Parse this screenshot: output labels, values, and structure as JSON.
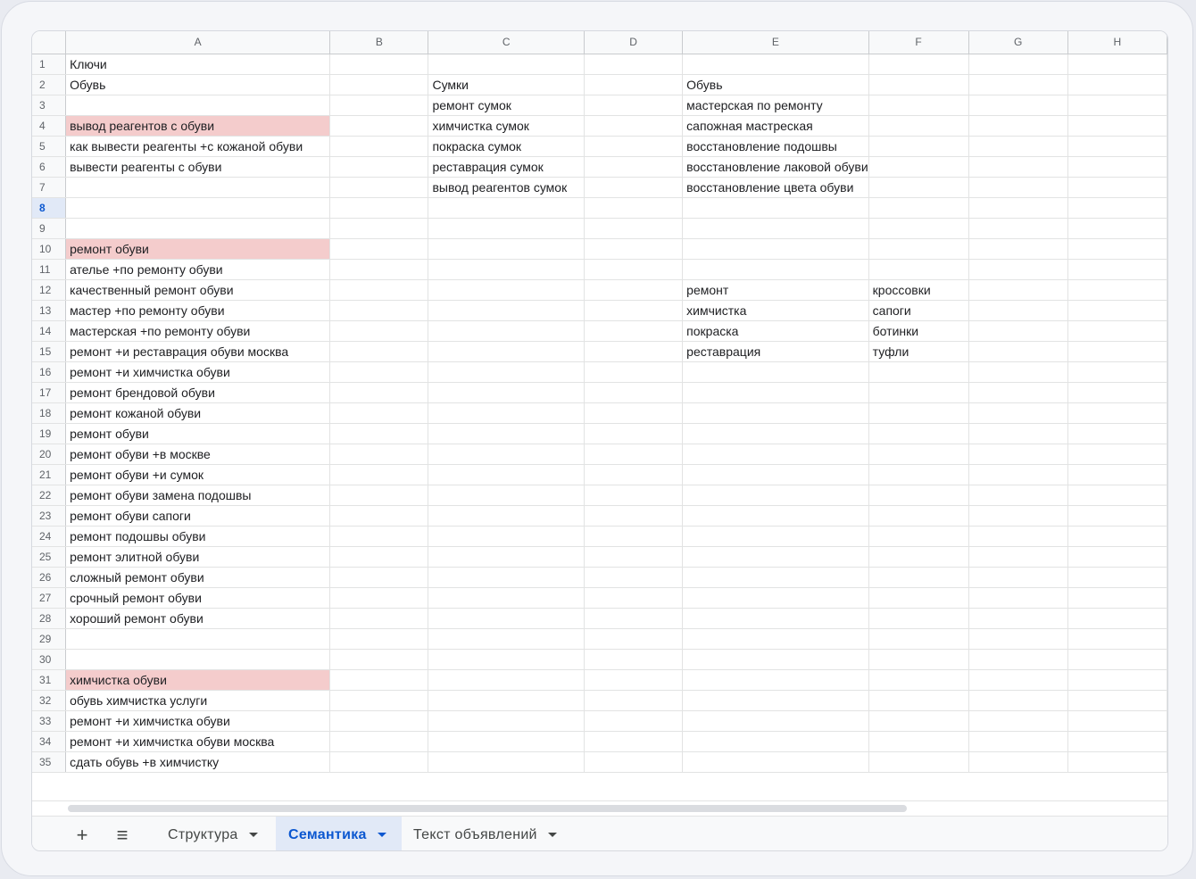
{
  "columns": [
    "A",
    "B",
    "C",
    "D",
    "E",
    "F",
    "G",
    "H"
  ],
  "active_row": 8,
  "highlight_color": "#f4cccc",
  "rows": [
    {
      "n": "1",
      "A": "Ключи"
    },
    {
      "n": "2",
      "A": "Обувь",
      "C": "Сумки",
      "E": "Обувь"
    },
    {
      "n": "3",
      "C": "ремонт сумок",
      "E": "мастерская по ремонту"
    },
    {
      "n": "4",
      "A": "вывод реагентов с обуви",
      "hl": true,
      "C": "химчистка сумок",
      "E": "сапожная мастреская"
    },
    {
      "n": "5",
      "A": "как вывести реагенты +с кожаной обуви",
      "C": "покраска сумок",
      "E": "восстановление подошвы"
    },
    {
      "n": "6",
      "A": "вывести реагенты с обуви",
      "C": "реставрация сумок",
      "E": "восстановление лаковой обуви"
    },
    {
      "n": "7",
      "C": "вывод реагентов сумок",
      "E": "восстановление цвета обуви"
    },
    {
      "n": "8"
    },
    {
      "n": "9"
    },
    {
      "n": "10",
      "A": "ремонт обуви",
      "hl": true
    },
    {
      "n": "11",
      "A": "ателье +по ремонту обуви"
    },
    {
      "n": "12",
      "A": "качественный ремонт обуви",
      "E": "ремонт",
      "F": "кроссовки"
    },
    {
      "n": "13",
      "A": "мастер +по ремонту обуви",
      "E": "химчистка",
      "F": "сапоги"
    },
    {
      "n": "14",
      "A": "мастерская +по ремонту обуви",
      "E": "покраска",
      "F": "ботинки"
    },
    {
      "n": "15",
      "A": "ремонт +и реставрация обуви москва",
      "E": "реставрация",
      "F": "туфли"
    },
    {
      "n": "16",
      "A": "ремонт +и химчистка обуви"
    },
    {
      "n": "17",
      "A": "ремонт брендовой обуви"
    },
    {
      "n": "18",
      "A": "ремонт кожаной обуви"
    },
    {
      "n": "19",
      "A": "ремонт обуви"
    },
    {
      "n": "20",
      "A": "ремонт обуви +в москве"
    },
    {
      "n": "21",
      "A": "ремонт обуви +и сумок"
    },
    {
      "n": "22",
      "A": "ремонт обуви замена подошвы"
    },
    {
      "n": "23",
      "A": "ремонт обуви сапоги"
    },
    {
      "n": "24",
      "A": "ремонт подошвы обуви"
    },
    {
      "n": "25",
      "A": "ремонт элитной обуви"
    },
    {
      "n": "26",
      "A": "сложный ремонт обуви"
    },
    {
      "n": "27",
      "A": "срочный ремонт обуви"
    },
    {
      "n": "28",
      "A": "хороший ремонт обуви"
    },
    {
      "n": "29"
    },
    {
      "n": "30"
    },
    {
      "n": "31",
      "A": "химчистка обуви",
      "hl": true
    },
    {
      "n": "32",
      "A": "обувь химчистка услуги"
    },
    {
      "n": "33",
      "A": "ремонт +и химчистка обуви"
    },
    {
      "n": "34",
      "A": "ремонт +и химчистка обуви москва"
    },
    {
      "n": "35",
      "A": "сдать обувь +в химчистку"
    }
  ],
  "toolbar": {
    "add_icon": "+",
    "menu_icon": "≡",
    "tabs": [
      {
        "label": "Структура",
        "active": false
      },
      {
        "label": "Семантика",
        "active": true
      },
      {
        "label": "Текст объявлений",
        "active": false
      }
    ]
  }
}
